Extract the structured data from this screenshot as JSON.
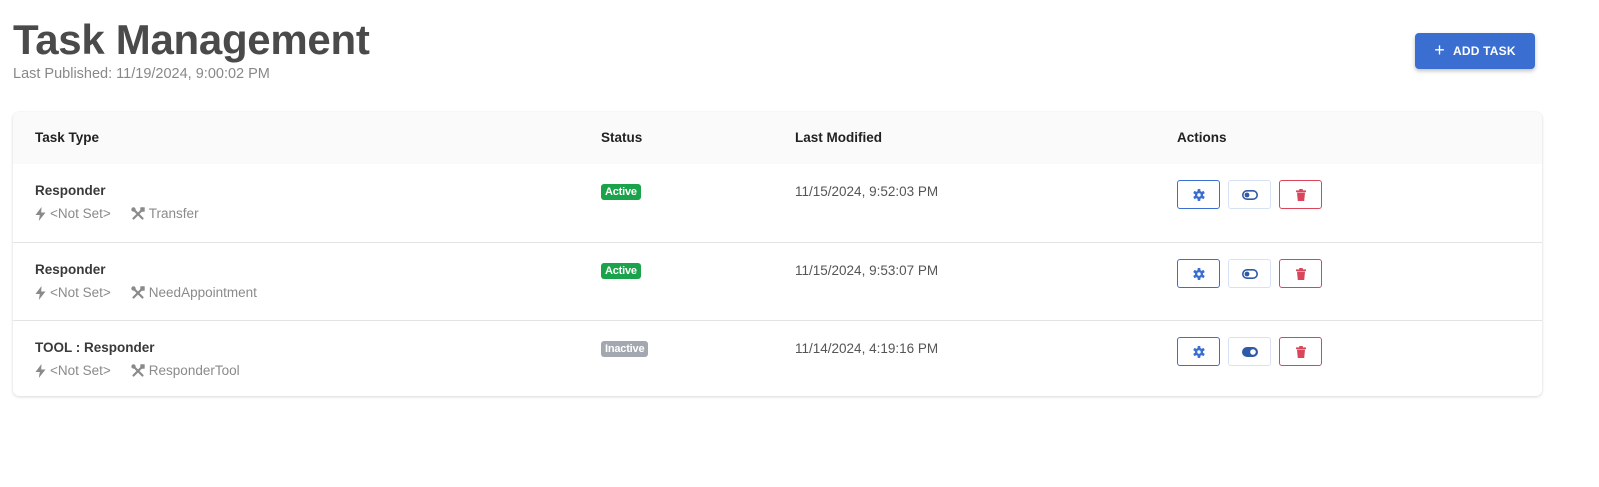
{
  "header": {
    "title": "Task Management",
    "last_published": "Last Published: 11/19/2024, 9:00:02 PM",
    "add_task_label": "ADD TASK"
  },
  "table": {
    "columns": [
      "Task Type",
      "Status",
      "Last Modified",
      "Actions"
    ],
    "rows": [
      {
        "name": "Responder",
        "trigger": "<Not Set>",
        "tools": "Transfer",
        "status": "Active",
        "last_modified": "11/15/2024, 9:52:03 PM",
        "toggle_state": "off"
      },
      {
        "name": "Responder",
        "trigger": "<Not Set>",
        "tools": "NeedAppointment",
        "status": "Active",
        "last_modified": "11/15/2024, 9:53:07 PM",
        "toggle_state": "off"
      },
      {
        "name": "TOOL : Responder",
        "trigger": "<Not Set>",
        "tools": "ResponderTool",
        "status": "Inactive",
        "last_modified": "11/14/2024, 4:19:16 PM",
        "toggle_state": "on"
      }
    ]
  },
  "icons": {
    "add": "plus-icon",
    "trigger": "bolt-icon",
    "tools": "tools-icon",
    "settings": "gear-icon",
    "toggle": "toggle-icon",
    "delete": "trash-icon"
  },
  "colors": {
    "primary": "#3a6fd1",
    "active": "#1aa34a",
    "inactive": "#a3a8b0",
    "danger": "#d9455a",
    "title": "#4a4a4a"
  }
}
